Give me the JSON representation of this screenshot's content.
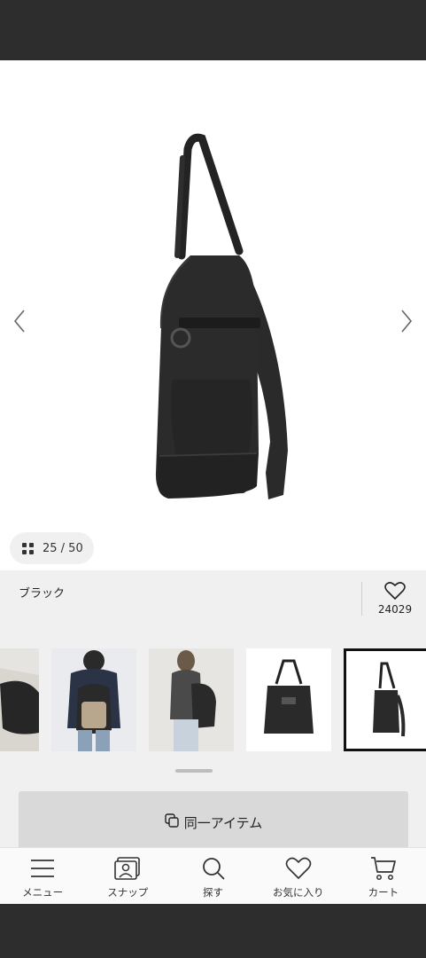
{
  "gallery": {
    "counter": "25 / 50",
    "icons": {
      "prev": "chevron-left-icon",
      "next": "chevron-right-icon",
      "grid": "grid-icon"
    }
  },
  "product": {
    "color_label": "ブラック",
    "favorite_count": "24029"
  },
  "actions": {
    "same_item_label": "同一アイテム"
  },
  "bottom_nav": {
    "menu": "メニュー",
    "snap": "スナップ",
    "search": "探す",
    "favorites": "お気に入り",
    "cart": "カート"
  }
}
